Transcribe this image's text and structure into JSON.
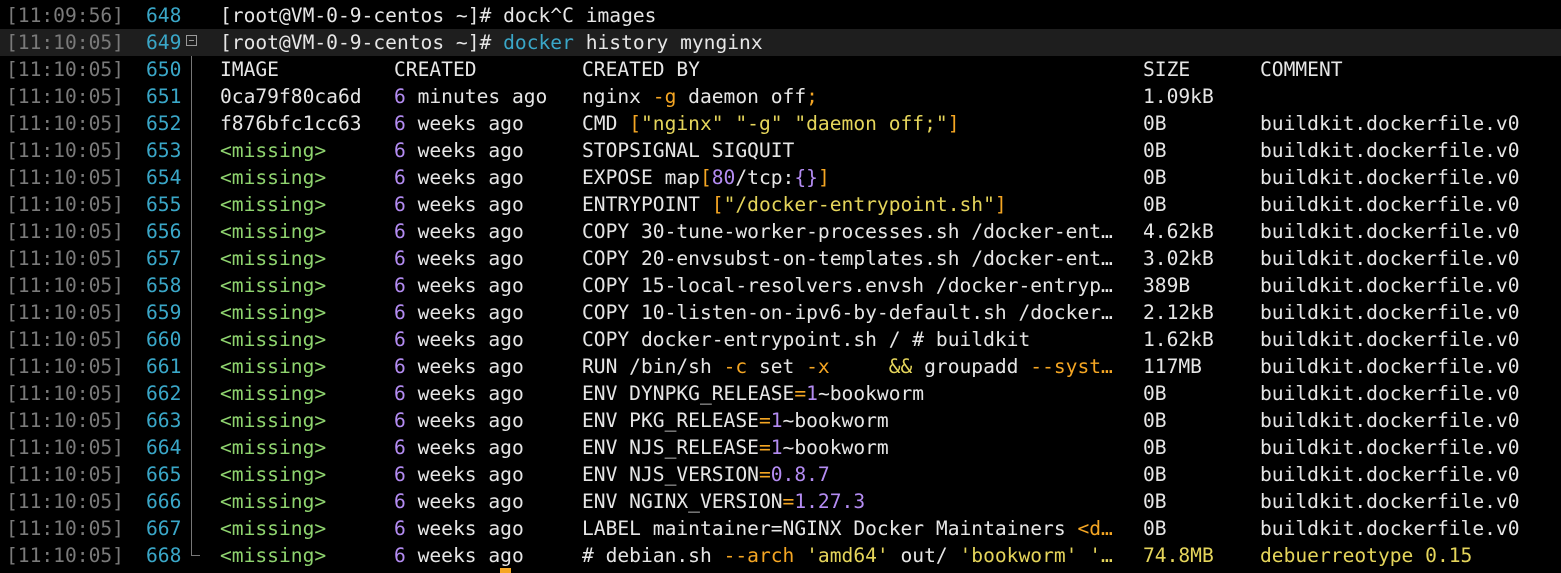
{
  "terminal": {
    "prompt": "[root@VM-0-9-centos ~]# ",
    "lines": [
      {
        "ts": "[11:09:56]",
        "ln": "648",
        "cmd_rest": "dock^C images"
      },
      {
        "ts": "[11:10:05]",
        "ln": "649",
        "cmd_word": "docker",
        "cmd_rest": " history mynginx"
      }
    ],
    "header": {
      "ts": "[11:10:05]",
      "ln": "650",
      "image": "IMAGE",
      "created": "CREATED",
      "created_by": "CREATED BY",
      "size": "SIZE",
      "comment": "COMMENT"
    },
    "rows": [
      {
        "ts": "[11:10:05]",
        "ln": "651",
        "image": "0ca79f80ca6d",
        "num": "6",
        "ago": " minutes ago",
        "by": [
          {
            "t": "nginx ",
            "c": "white"
          },
          {
            "t": "-g",
            "c": "orange"
          },
          {
            "t": " daemon off",
            "c": "white"
          },
          {
            "t": ";",
            "c": "orange"
          }
        ],
        "size": "1.09kB",
        "comment": ""
      },
      {
        "ts": "[11:10:05]",
        "ln": "652",
        "image": "f876bfc1cc63",
        "num": "6",
        "ago": " weeks ago",
        "by": [
          {
            "t": "CMD ",
            "c": "white"
          },
          {
            "t": "[",
            "c": "orange"
          },
          {
            "t": "\"nginx\" \"-g\" \"daemon off;\"",
            "c": "yellow"
          },
          {
            "t": "]",
            "c": "orange"
          }
        ],
        "size": "0B",
        "comment": "buildkit.dockerfile.v0"
      },
      {
        "ts": "[11:10:05]",
        "ln": "653",
        "image": "<missing>",
        "num": "6",
        "ago": " weeks ago",
        "by": [
          {
            "t": "STOPSIGNAL SIGQUIT",
            "c": "white"
          }
        ],
        "size": "0B",
        "comment": "buildkit.dockerfile.v0"
      },
      {
        "ts": "[11:10:05]",
        "ln": "654",
        "image": "<missing>",
        "num": "6",
        "ago": " weeks ago",
        "by": [
          {
            "t": "EXPOSE map",
            "c": "white"
          },
          {
            "t": "[",
            "c": "orange"
          },
          {
            "t": "80",
            "c": "purple"
          },
          {
            "t": "/tcp:",
            "c": "white"
          },
          {
            "t": "{}",
            "c": "purple"
          },
          {
            "t": "]",
            "c": "orange"
          }
        ],
        "size": "0B",
        "comment": "buildkit.dockerfile.v0"
      },
      {
        "ts": "[11:10:05]",
        "ln": "655",
        "image": "<missing>",
        "num": "6",
        "ago": " weeks ago",
        "by": [
          {
            "t": "ENTRYPOINT ",
            "c": "white"
          },
          {
            "t": "[",
            "c": "orange"
          },
          {
            "t": "\"/docker-entrypoint.sh\"",
            "c": "yellow"
          },
          {
            "t": "]",
            "c": "orange"
          }
        ],
        "size": "0B",
        "comment": "buildkit.dockerfile.v0"
      },
      {
        "ts": "[11:10:05]",
        "ln": "656",
        "image": "<missing>",
        "num": "6",
        "ago": " weeks ago",
        "by": [
          {
            "t": "COPY 30-tune-worker-processes.sh /docker-ent…",
            "c": "white"
          }
        ],
        "size": "4.62kB",
        "comment": "buildkit.dockerfile.v0"
      },
      {
        "ts": "[11:10:05]",
        "ln": "657",
        "image": "<missing>",
        "num": "6",
        "ago": " weeks ago",
        "by": [
          {
            "t": "COPY 20-envsubst-on-templates.sh /docker-ent…",
            "c": "white"
          }
        ],
        "size": "3.02kB",
        "comment": "buildkit.dockerfile.v0"
      },
      {
        "ts": "[11:10:05]",
        "ln": "658",
        "image": "<missing>",
        "num": "6",
        "ago": " weeks ago",
        "by": [
          {
            "t": "COPY 15-local-resolvers.envsh /docker-entryp…",
            "c": "white"
          }
        ],
        "size": "389B",
        "comment": "buildkit.dockerfile.v0"
      },
      {
        "ts": "[11:10:05]",
        "ln": "659",
        "image": "<missing>",
        "num": "6",
        "ago": " weeks ago",
        "by": [
          {
            "t": "COPY 10-listen-on-ipv6-by-default.sh /docker…",
            "c": "white"
          }
        ],
        "size": "2.12kB",
        "comment": "buildkit.dockerfile.v0"
      },
      {
        "ts": "[11:10:05]",
        "ln": "660",
        "image": "<missing>",
        "num": "6",
        "ago": " weeks ago",
        "by": [
          {
            "t": "COPY docker-entrypoint.sh / # buildkit",
            "c": "white"
          }
        ],
        "size": "1.62kB",
        "comment": "buildkit.dockerfile.v0"
      },
      {
        "ts": "[11:10:05]",
        "ln": "661",
        "image": "<missing>",
        "num": "6",
        "ago": " weeks ago",
        "by": [
          {
            "t": "RUN /bin/sh ",
            "c": "white"
          },
          {
            "t": "-c",
            "c": "orange"
          },
          {
            "t": " set ",
            "c": "white"
          },
          {
            "t": "-x",
            "c": "orange"
          },
          {
            "t": "     ",
            "c": "white"
          },
          {
            "t": "&&",
            "c": "yellow"
          },
          {
            "t": " groupadd ",
            "c": "white"
          },
          {
            "t": "--syst…",
            "c": "orange"
          }
        ],
        "size": "117MB",
        "comment": "buildkit.dockerfile.v0"
      },
      {
        "ts": "[11:10:05]",
        "ln": "662",
        "image": "<missing>",
        "num": "6",
        "ago": " weeks ago",
        "by": [
          {
            "t": "ENV DYNPKG_RELEASE",
            "c": "white"
          },
          {
            "t": "=",
            "c": "orange"
          },
          {
            "t": "1",
            "c": "purple"
          },
          {
            "t": "~bookworm",
            "c": "white"
          }
        ],
        "size": "0B",
        "comment": "buildkit.dockerfile.v0"
      },
      {
        "ts": "[11:10:05]",
        "ln": "663",
        "image": "<missing>",
        "num": "6",
        "ago": " weeks ago",
        "by": [
          {
            "t": "ENV PKG_RELEASE",
            "c": "white"
          },
          {
            "t": "=",
            "c": "orange"
          },
          {
            "t": "1",
            "c": "purple"
          },
          {
            "t": "~bookworm",
            "c": "white"
          }
        ],
        "size": "0B",
        "comment": "buildkit.dockerfile.v0"
      },
      {
        "ts": "[11:10:05]",
        "ln": "664",
        "image": "<missing>",
        "num": "6",
        "ago": " weeks ago",
        "by": [
          {
            "t": "ENV NJS_RELEASE",
            "c": "white"
          },
          {
            "t": "=",
            "c": "orange"
          },
          {
            "t": "1",
            "c": "purple"
          },
          {
            "t": "~bookworm",
            "c": "white"
          }
        ],
        "size": "0B",
        "comment": "buildkit.dockerfile.v0"
      },
      {
        "ts": "[11:10:05]",
        "ln": "665",
        "image": "<missing>",
        "num": "6",
        "ago": " weeks ago",
        "by": [
          {
            "t": "ENV NJS_VERSION",
            "c": "white"
          },
          {
            "t": "=",
            "c": "orange"
          },
          {
            "t": "0.8.7",
            "c": "purple"
          }
        ],
        "size": "0B",
        "comment": "buildkit.dockerfile.v0"
      },
      {
        "ts": "[11:10:05]",
        "ln": "666",
        "image": "<missing>",
        "num": "6",
        "ago": " weeks ago",
        "by": [
          {
            "t": "ENV NGINX_VERSION",
            "c": "white"
          },
          {
            "t": "=",
            "c": "orange"
          },
          {
            "t": "1.27.3",
            "c": "purple"
          }
        ],
        "size": "0B",
        "comment": "buildkit.dockerfile.v0"
      },
      {
        "ts": "[11:10:05]",
        "ln": "667",
        "image": "<missing>",
        "num": "6",
        "ago": " weeks ago",
        "by": [
          {
            "t": "LABEL maintainer=NGINX Docker Maintainers ",
            "c": "white"
          },
          {
            "t": "<d…",
            "c": "orange"
          }
        ],
        "size": "0B",
        "comment": "buildkit.dockerfile.v0"
      },
      {
        "ts": "[11:10:05]",
        "ln": "668",
        "image": "<missing>",
        "num": "6",
        "ago": " weeks ago",
        "by": [
          {
            "t": "# debian.sh ",
            "c": "white"
          },
          {
            "t": "--arch",
            "c": "orange"
          },
          {
            "t": " ",
            "c": "white"
          },
          {
            "t": "'amd64'",
            "c": "yellow"
          },
          {
            "t": " out/ ",
            "c": "white"
          },
          {
            "t": "'bookworm'",
            "c": "yellow"
          },
          {
            "t": " '…",
            "c": "yellow"
          }
        ],
        "size": "74.8MB",
        "comment": "debuerreotype 0.15",
        "last_highlight": true
      }
    ]
  }
}
